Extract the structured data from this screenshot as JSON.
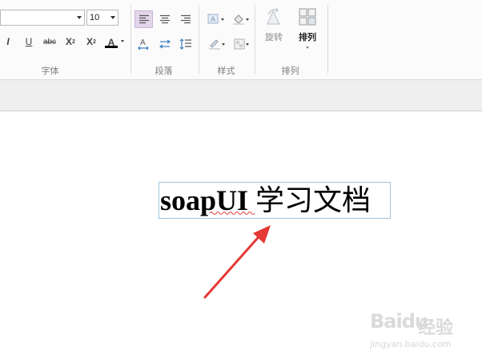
{
  "ribbon": {
    "font_size_value": "10",
    "groups": {
      "font": "字体",
      "paragraph": "段落",
      "style": "样式",
      "arrange": "排列"
    },
    "format_buttons": {
      "italic": "I",
      "underline": "U",
      "strikethrough": "abc",
      "superscript_base": "X",
      "superscript_mark": "2",
      "subscript_base": "X",
      "subscript_mark": "2",
      "font_color": "A"
    },
    "arrange_buttons": {
      "rotate": "旋转",
      "arrange": "排列"
    }
  },
  "document": {
    "text_bold": "soapUI",
    "text_regular": " 学习文档"
  },
  "watermark": {
    "brand": "Baidu",
    "brand_cn": "经验",
    "url": "jingyan.baidu.com"
  },
  "colors": {
    "selected_button_bg": "#e3d5ea",
    "arrow": "#e53935",
    "textbox_border": "#9fc3dd",
    "font_color_bar": "#000000"
  }
}
